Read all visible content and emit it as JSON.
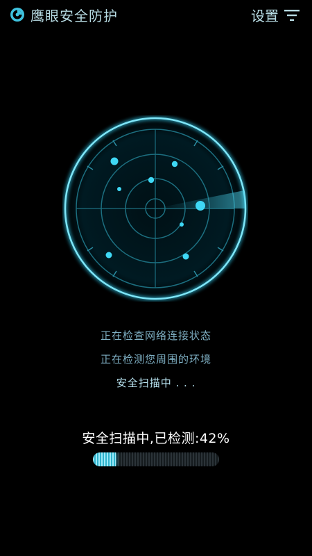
{
  "header": {
    "title": "鹰眼安全防护",
    "settings_label": "设置",
    "logo_icon": "eye-shield-icon",
    "menu_icon": "filter-icon"
  },
  "status": {
    "line1": "正在检查网络连接状态",
    "line2": "正在检测您周围的环境",
    "line3": "安全扫描中 . . ."
  },
  "progress": {
    "text": "安全扫描中,已检测:42%",
    "value": 0.18
  },
  "colors": {
    "accent": "#39d0ee",
    "background": "#000000"
  }
}
